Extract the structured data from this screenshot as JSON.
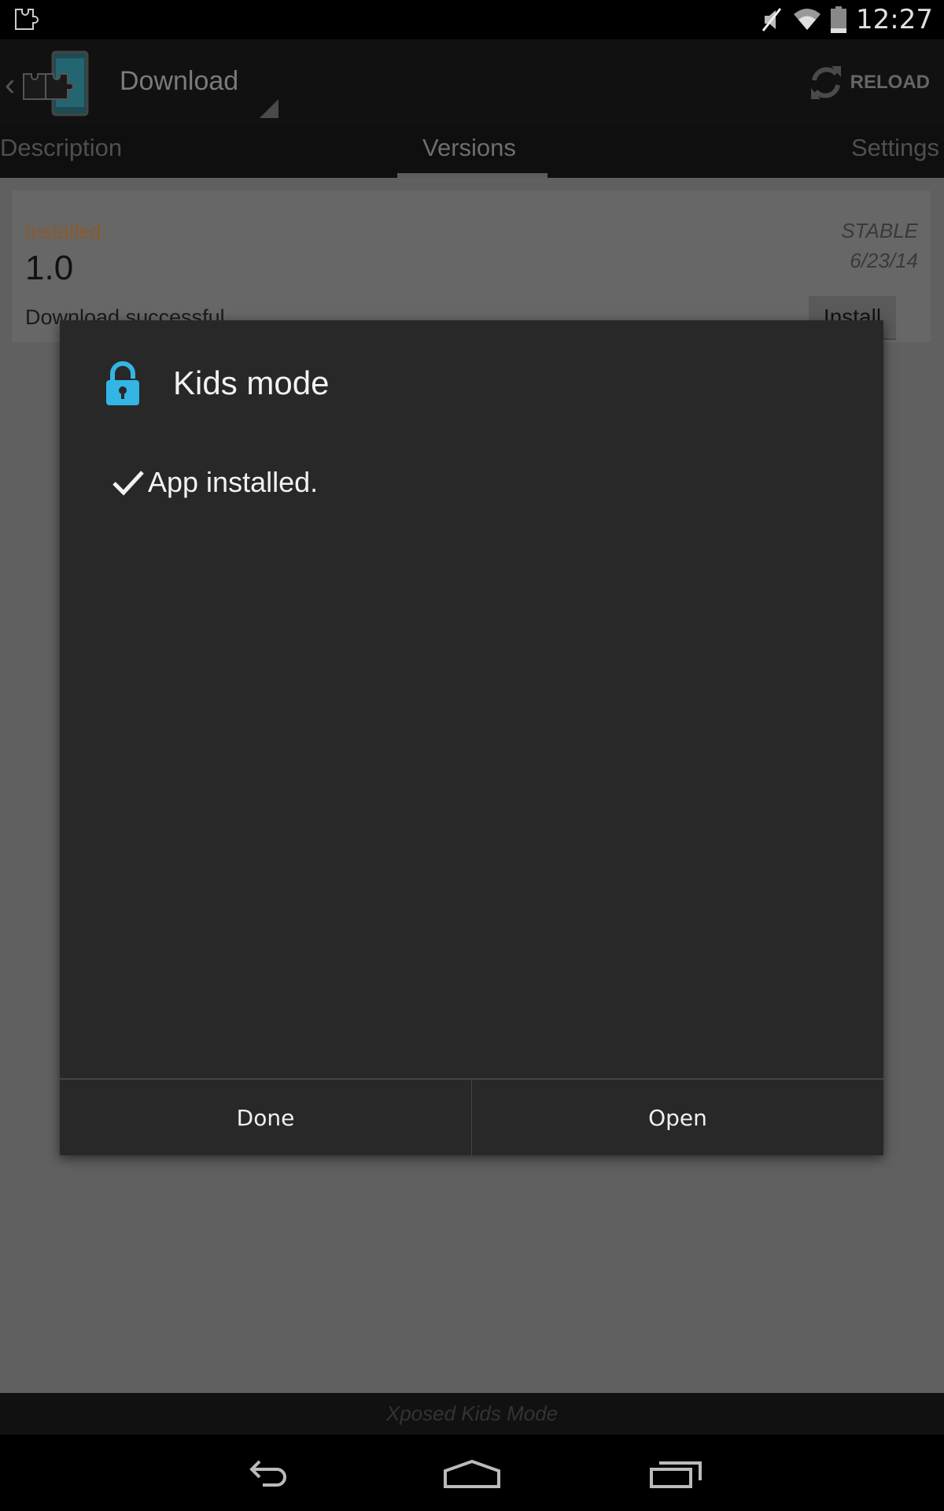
{
  "status_bar": {
    "time": "12:27",
    "icons": [
      "xposed-notification-icon",
      "mute-icon",
      "wifi-icon",
      "battery-icon"
    ]
  },
  "action_bar": {
    "title": "Download",
    "reload_label": "RELOAD"
  },
  "tabs": [
    {
      "label": "Description",
      "active": false
    },
    {
      "label": "Versions",
      "active": true
    },
    {
      "label": "Settings",
      "active": false
    }
  ],
  "version_card": {
    "installed_label": "Installed:",
    "version": "1.0",
    "status": "Download successful",
    "release_type": "STABLE",
    "date": "6/23/14",
    "install_label": "Install"
  },
  "dialog": {
    "title": "Kids mode",
    "message": "App installed.",
    "buttons": {
      "done": "Done",
      "open": "Open"
    }
  },
  "footer": {
    "text": "Xposed Kids Mode"
  },
  "colors": {
    "lock_blue": "#33b5e5",
    "installed_orange": "#8c5a2a"
  }
}
